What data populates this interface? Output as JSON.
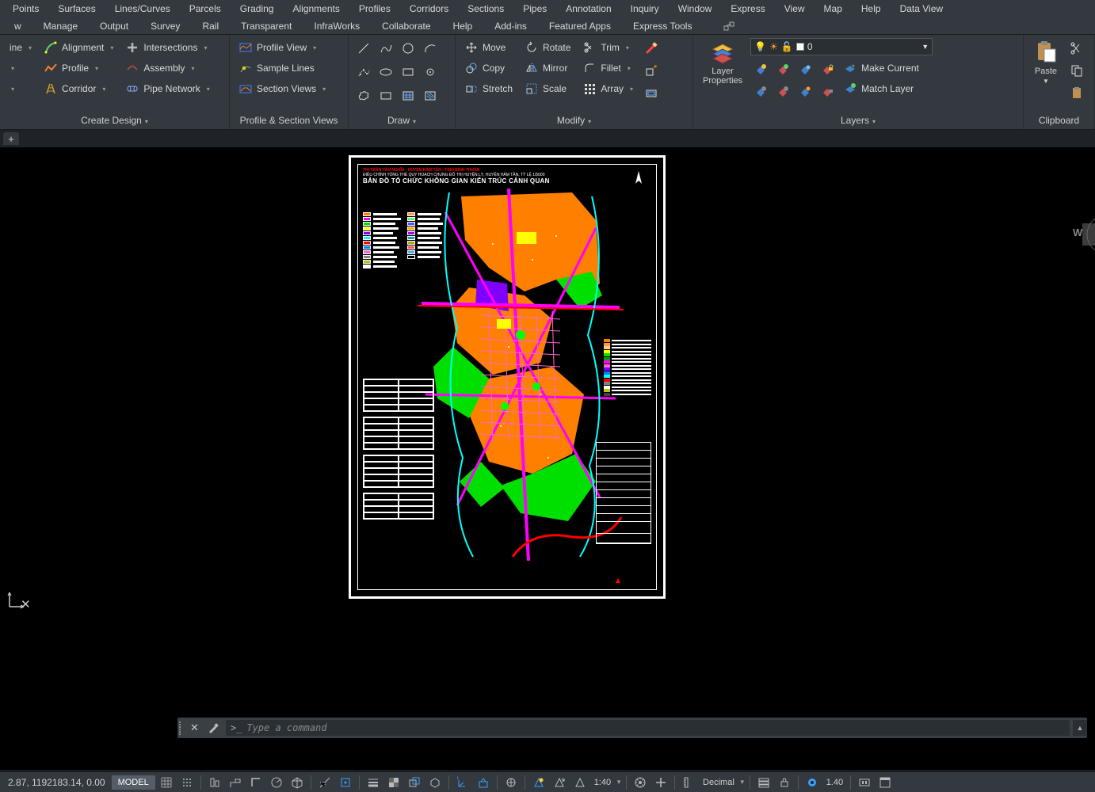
{
  "menubar1": [
    "Points",
    "Surfaces",
    "Lines/Curves",
    "Parcels",
    "Grading",
    "Alignments",
    "Profiles",
    "Corridors",
    "Sections",
    "Pipes",
    "Annotation",
    "Inquiry",
    "Window",
    "Express",
    "View",
    "Map",
    "Help",
    "Data View"
  ],
  "menubar2": [
    "w",
    "Manage",
    "Output",
    "Survey",
    "Rail",
    "Transparent",
    "InfraWorks",
    "Collaborate",
    "Help",
    "Add-ins",
    "Featured Apps",
    "Express Tools"
  ],
  "ribbon": {
    "create_design": {
      "title": "Create Design",
      "col1": [
        "ine",
        "",
        ""
      ],
      "col2": [
        "Alignment",
        "Profile",
        "Corridor"
      ],
      "col3": [
        "Intersections",
        "Assembly",
        "Pipe Network"
      ]
    },
    "profile_section": {
      "title": "Profile & Section Views",
      "items": [
        "Profile View",
        "Sample Lines",
        "Section Views"
      ]
    },
    "draw": {
      "title": "Draw"
    },
    "modify": {
      "title": "Modify",
      "col1": [
        "Move",
        "Copy",
        "Stretch"
      ],
      "col2": [
        "Rotate",
        "Mirror",
        "Scale"
      ],
      "col3": [
        "Trim",
        "Fillet",
        "Array"
      ]
    },
    "layers": {
      "title": "Layers",
      "prop_label": "Layer\nProperties",
      "current": "0",
      "make_current": "Make Current",
      "match_layer": "Match Layer"
    },
    "clipboard": {
      "title": "Clipboard",
      "paste": "Paste"
    }
  },
  "sheet": {
    "project": "THỊ TRẤN TÂN NGHĨA - HUYỆN HÀM TÂN - TỈNH BÌNH THUẬN",
    "sub": "ĐIỀU CHỈNH TỔNG THỂ QUY HOẠCH CHUNG ĐÔ THỊ HUYỆN LỴ, HUYỆN HÀM TÂN, TỶ LỆ 1/5000",
    "title": "BẢN ĐỒ TỔ CHỨC KHÔNG GIAN KIẾN TRÚC CẢNH QUAN"
  },
  "viewcube": {
    "face": "W"
  },
  "command": {
    "placeholder": "Type a command",
    "prompt": ">_"
  },
  "status": {
    "coords": "2.87, 1192183.14, 0.00",
    "model": "MODEL",
    "scale": "1:40",
    "units": "Decimal",
    "zoom": "1.40"
  }
}
